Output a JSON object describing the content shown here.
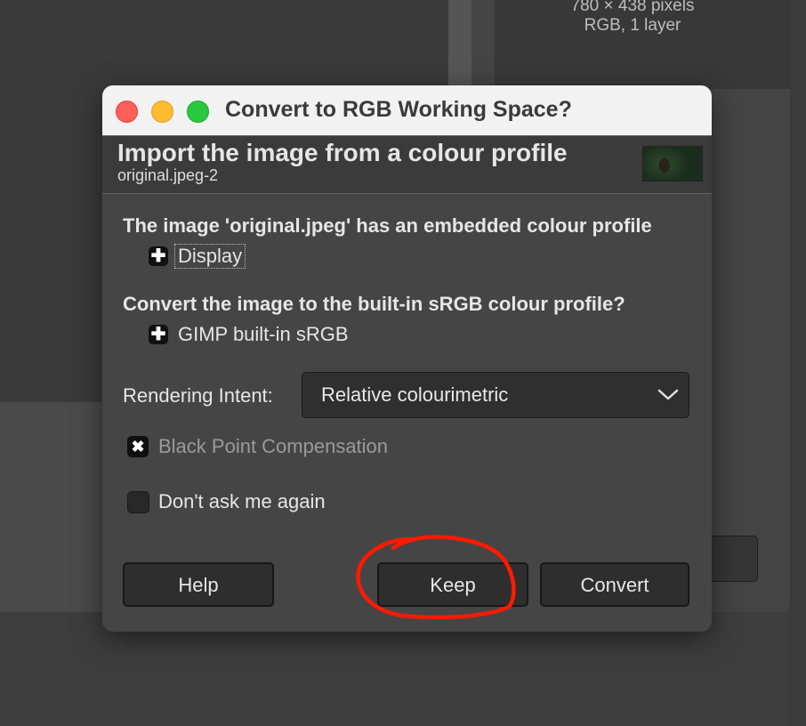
{
  "background": {
    "image_info_line1": "780 × 438 pixels",
    "image_info_line2": "RGB, 1 layer"
  },
  "dialog": {
    "title": "Convert to RGB Working Space?",
    "header_title": "Import the image from a colour profile",
    "header_subtitle": "original.jpeg-2",
    "embedded_text": "The image 'original.jpeg' has an embedded colour profile",
    "embedded_profile_name": "Display",
    "convert_question": "Convert the image to the built-in sRGB colour profile?",
    "builtin_profile_name": "GIMP built-in sRGB",
    "expander_glyph": "✚",
    "rendering_intent_label": "Rendering Intent:",
    "rendering_intent_value": "Relative colourimetric",
    "black_point_label": "Black Point Compensation",
    "black_point_checked": true,
    "black_point_glyph": "✖",
    "dont_ask_label": "Don't ask me again",
    "dont_ask_checked": false,
    "buttons": {
      "help": "Help",
      "keep": "Keep",
      "convert": "Convert"
    }
  },
  "colors": {
    "annotation": "#ff1a00",
    "traffic_red": "#ff5f57",
    "traffic_yellow": "#febc2e",
    "traffic_green": "#28c840",
    "disabled_text": "#9a9a9a"
  }
}
